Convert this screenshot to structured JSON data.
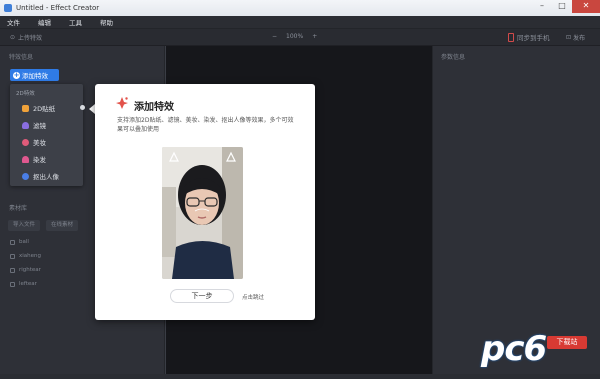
{
  "window": {
    "title": "Untitled - Effect Creator",
    "controls": [
      "–",
      "□",
      "✕"
    ]
  },
  "menu": [
    "文件",
    "编辑",
    "工具",
    "帮助"
  ],
  "toolbar": {
    "upload_label": "上传特效",
    "zoom_value": "100%",
    "zoom_minus": "−",
    "zoom_plus": "+",
    "sync_label": "同步到手机",
    "publish_label": "发布"
  },
  "left_panel": {
    "title": "特效信息",
    "add_button": "添加特效",
    "dropdown": {
      "category": "2D特效",
      "items": [
        {
          "label": "2D贴纸",
          "color": "#f0a23a"
        },
        {
          "label": "滤镜",
          "color": "#8a6ee0"
        },
        {
          "label": "美妆",
          "color": "#e05b7a"
        },
        {
          "label": "染发",
          "color": "#e0588f"
        },
        {
          "label": "抠出人像",
          "color": "#4a7ee6"
        }
      ]
    },
    "assets_title": "素材库",
    "asset_buttons": [
      "导入文件",
      "在线素材"
    ],
    "asset_items": [
      "ball",
      "xiaheng",
      "rightear",
      "leftear"
    ]
  },
  "right_panel": {
    "title": "参数信息"
  },
  "modal": {
    "title": "添加特效",
    "description": "支持添加2D贴纸、滤镜、美妆、染发、抠出人像等效果，多个可效果可以叠加使用",
    "next_button": "下一步",
    "skip_link": "点击跳过"
  },
  "watermark": {
    "text": "pc6",
    "sub": "下载站"
  }
}
